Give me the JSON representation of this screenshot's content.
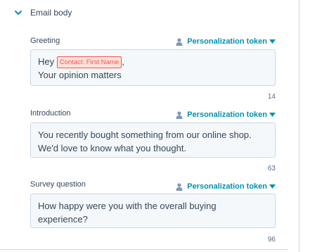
{
  "section": {
    "title": "Email body"
  },
  "token_link_label": "Personalization token",
  "fields": [
    {
      "label": "Greeting",
      "line1_prefix": "Hey",
      "token_chip": "Contact: First Name",
      "line1_suffix": ",",
      "line2": "Your opinion matters",
      "count": "14"
    },
    {
      "label": "Introduction",
      "line1": "You recently bought something from our online shop.",
      "line2": "We'd love to know what you thought.",
      "count": "63"
    },
    {
      "label": "Survey question",
      "line1": "How happy were you with the overall buying",
      "line2": "experience?",
      "count": "96"
    }
  ],
  "colors": {
    "accent": "#0091ae",
    "chip_text": "#f2545b",
    "chip_bg": "#fde0d6",
    "field_bg": "#f5f8fa",
    "border": "#cbd6e2",
    "text": "#33475b"
  }
}
